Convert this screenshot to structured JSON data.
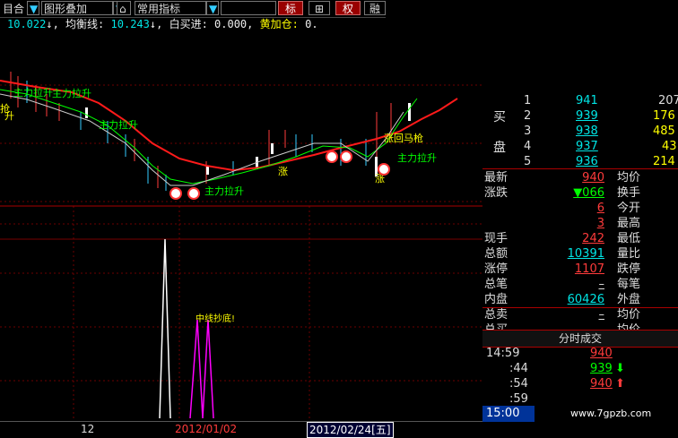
{
  "toolbar": {
    "items": [
      {
        "label": "目合",
        "kind": "text"
      },
      {
        "label": "▼",
        "kind": "dropdown"
      },
      {
        "label": "图形叠加",
        "kind": "text"
      },
      {
        "label": "▼",
        "kind": "dropdown"
      },
      {
        "label": "⌂",
        "kind": "icon"
      },
      {
        "label": "常用指标",
        "kind": "text"
      },
      {
        "label": "▼",
        "kind": "dropdown"
      },
      {
        "label": "标",
        "kind": "red"
      },
      {
        "label": "⊞",
        "kind": "icon"
      },
      {
        "label": "权",
        "kind": "red"
      },
      {
        "label": "融",
        "kind": "text"
      }
    ]
  },
  "indicator_line": {
    "value1": "10.022",
    "ma_label": "均衡线:",
    "ma_value": "10.243",
    "buy_label": "白买进:",
    "buy_value": "0.000,",
    "add_label": "黄加仓:",
    "add_value": "0."
  },
  "chart_annotations": [
    {
      "text": "主力拉升",
      "color": "#00ff00"
    },
    {
      "text": "主力拉升",
      "color": "#00ff00"
    },
    {
      "text": "主力拉升",
      "color": "#00ff00"
    },
    {
      "text": "主力拉升",
      "color": "#00ff00"
    },
    {
      "text": "涨",
      "color": "#ffff00"
    },
    {
      "text": "涨回马枪",
      "color": "#ffff00"
    },
    {
      "text": "抢",
      "color": "#ffff00"
    },
    {
      "text": "升",
      "color": "#ffff00"
    },
    {
      "text": "涨",
      "color": "#ffff00"
    },
    {
      "text": "中线抄底",
      "color": "#ffff00"
    }
  ],
  "quote_panel": {
    "bid_label_top": "买",
    "bid_label_bottom": "盘",
    "bids": [
      {
        "level": "1",
        "price": "941",
        "vol": "207"
      },
      {
        "level": "2",
        "price": "939",
        "vol": "176"
      },
      {
        "level": "3",
        "price": "938",
        "vol": "485"
      },
      {
        "level": "4",
        "price": "937",
        "vol": "43"
      },
      {
        "level": "5",
        "price": "936",
        "vol": "214"
      }
    ],
    "stats": [
      {
        "label": "最新",
        "value": "940",
        "label2": "均价",
        "color": "#ff3b3b"
      },
      {
        "label": "涨跌",
        "value": "▼066",
        "label2": "换手",
        "color": "#00ff00"
      },
      {
        "label": "",
        "value": "6",
        "label2": "今开",
        "color": "#ff3b3b"
      },
      {
        "label": "",
        "value": "3",
        "label2": "最高",
        "color": "#ff3b3b"
      },
      {
        "label": "现手",
        "value": "242",
        "label2": "最低",
        "color": "#ff3b3b"
      },
      {
        "label": "总额",
        "value": "10391",
        "label2": "量比",
        "color": "#00e5e5"
      },
      {
        "label": "涨停",
        "value": "1107",
        "label2": "跌停",
        "color": "#ff3b3b"
      },
      {
        "label": "总笔",
        "value": "–",
        "label2": "每笔",
        "color": "#ddd"
      },
      {
        "label": "内盘",
        "value": "60426",
        "label2": "外盘",
        "color": "#00e5e5"
      },
      {
        "label": "总卖",
        "value": "–",
        "label2": "均价",
        "color": "#ddd"
      },
      {
        "label": "总买",
        "value": "–",
        "label2": "均价",
        "color": "#ddd"
      }
    ],
    "ticks_header": "分时成交",
    "ticks": [
      {
        "time": "14:59",
        "price": "940",
        "arrow": "",
        "color": "#ff3b3b"
      },
      {
        "time": ":44",
        "price": "939",
        "arrow": "⬇",
        "color": "#00ff00"
      },
      {
        "time": ":54",
        "price": "940",
        "arrow": "⬆",
        "color": "#ff3b3b"
      },
      {
        "time": ":59",
        "price": "",
        "arrow": "",
        "color": "#ddd"
      }
    ],
    "current_time": "15:00",
    "watermark": "www.7gpzb.com"
  },
  "bottom_bar": {
    "left_label": "12",
    "date1": "2012/01/02",
    "date2": "2012/02/24[五]"
  },
  "volume_label": "中线抄底!"
}
